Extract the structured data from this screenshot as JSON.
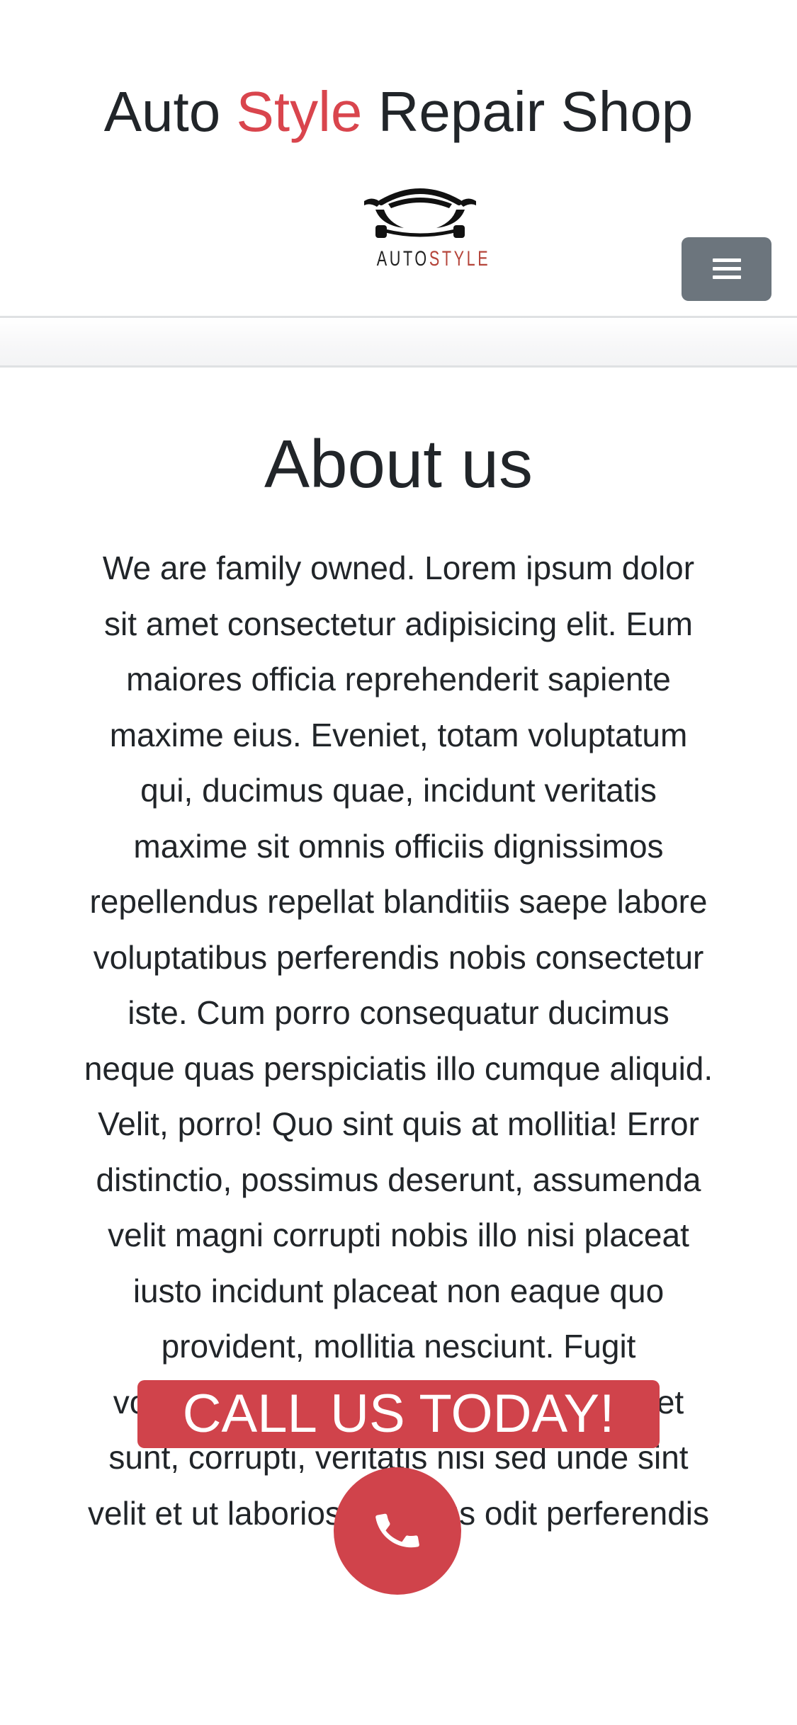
{
  "header": {
    "title_part1": "Auto ",
    "title_accent": "Style",
    "title_part2": " Repair Shop",
    "logo": {
      "icon": "car-silhouette-icon",
      "text_part1": "AUTO",
      "text_part2": "STYLE"
    },
    "menu_icon": "hamburger-menu-icon"
  },
  "about": {
    "title": "About us",
    "body": "We are family owned. Lorem ipsum dolor sit amet consectetur adipisicing elit. Eum maiores officia reprehenderit sapiente maxime eius. Eveniet, totam voluptatum qui, ducimus quae, incidunt veritatis maxime sit omnis officiis dignissimos repellendus repellat blanditiis saepe labore voluptatibus perferendis nobis consectetur iste. Cum porro consequatur ducimus neque quas perspiciatis illo cumque aliquid. Velit, porro! Quo sint quis at mollitia! Error distinctio, possimus deserunt, assumenda velit magni corrupti nobis illo nisi placeat iusto incidunt placeat non eaque quo provident, mollitia nesciunt. Fugit voluptates quos minima! Earum eveniet sunt, corrupti, veritatis nisi sed unde sint velit et ut laboriosam natus odit perferendis"
  },
  "cta": {
    "label": "CALL US TODAY!",
    "call_icon": "phone-icon"
  },
  "colors": {
    "accent": "#d9454d",
    "cta_background": "#d0434b",
    "menu_button": "#6c757d",
    "text": "#212529",
    "logo_style_text": "#b5443a"
  }
}
